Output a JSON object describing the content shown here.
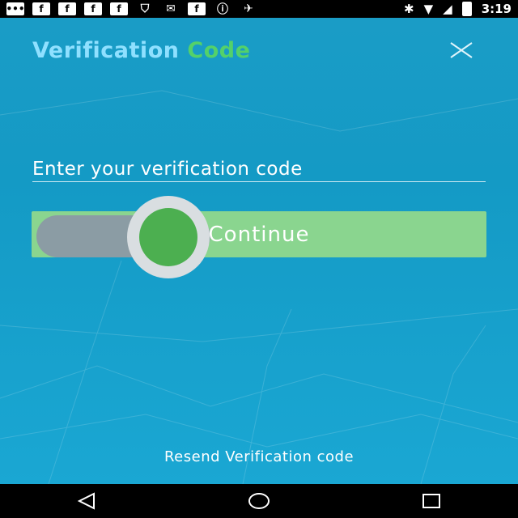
{
  "status_bar": {
    "time": "3:19",
    "icons": [
      "message-icon",
      "facebook-icon",
      "facebook-icon",
      "facebook-icon",
      "facebook-icon",
      "shield-icon",
      "mail-icon",
      "facebook-icon",
      "info-icon",
      "satellite-icon",
      "bluetooth-icon",
      "wifi-icon",
      "signal-icon",
      "battery-icon"
    ]
  },
  "header": {
    "title_part1": "Verification",
    "title_part2": "Code",
    "title_part1_color": "#8fe0ff",
    "title_part2_color": "#53d16a"
  },
  "form": {
    "code_placeholder": "Enter your verification code",
    "code_value": "",
    "continue_label": "Continue"
  },
  "footer": {
    "resend_label": "Resend Verification code"
  },
  "colors": {
    "background": "#1a9cc6",
    "button": "#8ad58f",
    "knob": "#4caf50"
  }
}
